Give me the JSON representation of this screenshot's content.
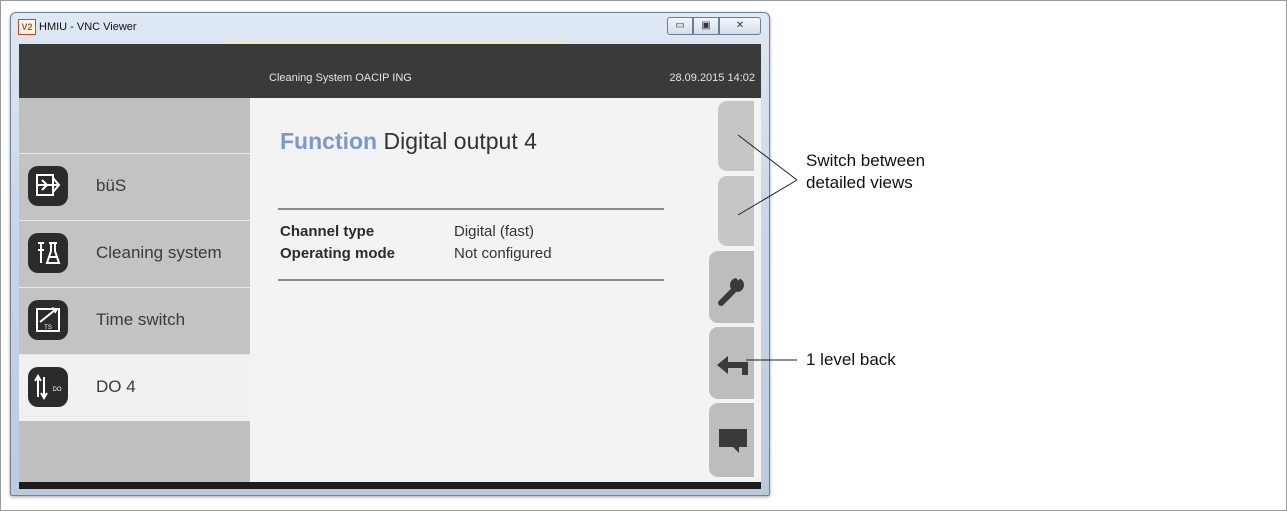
{
  "window": {
    "title": "HMIU - VNC Viewer",
    "app_icon_text": "V2",
    "minimize_glyph": "▭",
    "maximize_glyph": "▣",
    "close_glyph": "✕"
  },
  "hmi": {
    "header": {
      "path": "Cleaning System  OACIP ING",
      "clock": "28.09.2015  14:02"
    },
    "sidebar": {
      "items": [
        {
          "label": "büS",
          "icon": "bus-icon",
          "active": false
        },
        {
          "label": "Cleaning system",
          "icon": "cleaning-system-icon",
          "active": false
        },
        {
          "label": "Time switch",
          "icon": "time-switch-icon",
          "icon_text": "TS",
          "active": false
        },
        {
          "label": "DO 4",
          "icon": "digital-output-icon",
          "icon_text": "DO",
          "active": true
        }
      ]
    },
    "content": {
      "title_keyword": "Function",
      "title_text": "Digital output 4",
      "properties": [
        {
          "label": "Channel type",
          "value": "Digital (fast)"
        },
        {
          "label": "Operating mode",
          "value": "Not configured"
        }
      ]
    },
    "rail": {
      "tabs": [
        "detail-view-tab-1",
        "detail-view-tab-2",
        "wrench-icon",
        "back-arrow-icon",
        "message-icon"
      ]
    }
  },
  "annotations": {
    "switch_views_line1": "Switch between",
    "switch_views_line2": "detailed views",
    "back": "1 level back"
  },
  "colors": {
    "function_keyword": "#7d98c9",
    "header": "#3a3a3a",
    "sidebar": "#c0c0c0",
    "active_item": "#f1f1f1",
    "tab": "#bdbdbd"
  }
}
